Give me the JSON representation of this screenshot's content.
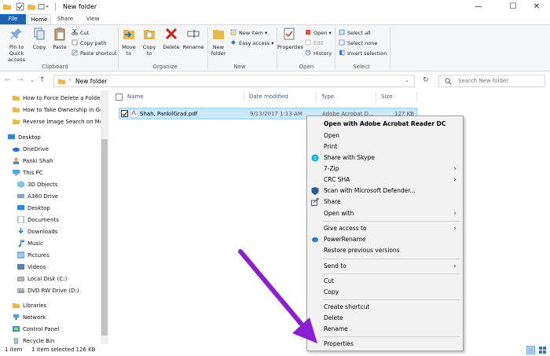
{
  "window": {
    "title": "New folder",
    "controls": {
      "minimize": "—",
      "maximize": "☐",
      "close": "✕"
    }
  },
  "ribbon_tabs": [
    "File",
    "Home",
    "Share",
    "View"
  ],
  "ribbon": {
    "pin": "Pin to Quick access",
    "copy": "Copy",
    "paste": "Paste",
    "cut": "Cut",
    "copy_path": "Copy path",
    "paste_shortcut": "Paste shortcut",
    "move_to": "Move to",
    "copy_to": "Copy to",
    "delete": "Delete",
    "rename": "Rename",
    "new_folder": "New folder",
    "new_item": "New item",
    "easy_access": "Easy access",
    "properties": "Properties",
    "open": "Open",
    "edit": "Edit",
    "history": "History",
    "select_all": "Select all",
    "select_none": "Select none",
    "invert_selection": "Invert selection",
    "groups": {
      "clipboard": "Clipboard",
      "organize": "Organize",
      "new": "New",
      "open": "Open",
      "select": "Select"
    }
  },
  "address": {
    "path": "New folder",
    "search_placeholder": "Search New folder"
  },
  "nav_pane": {
    "quick": [
      "How to Force Delete a Folder",
      "How to Take Ownership in Go",
      "Reverse Image Search on Mo"
    ],
    "desktop": "Desktop",
    "onedrive": "OneDrive",
    "user": "Panki Shah",
    "this_pc": "This PC",
    "pc_items": [
      "3D Objects",
      "A360 Drive",
      "Desktop",
      "Documents",
      "Downloads",
      "Music",
      "Pictures",
      "Videos",
      "Local Disk (C:)",
      "DVD RW Drive (D:)"
    ],
    "libraries": "Libraries",
    "network": "Network",
    "control_panel": "Control Panel",
    "recycle_bin": "Recycle Bin"
  },
  "columns": {
    "name": "Name",
    "date": "Date modified",
    "type": "Type",
    "size": "Size"
  },
  "files": [
    {
      "name": "Shah, PankilGrad.pdf",
      "date": "9/13/2017 1:13 AM",
      "type": "Adobe Acrobat D...",
      "size": "127 KB"
    }
  ],
  "context_menu": {
    "open_with_acrobat": "Open with Adobe Acrobat Reader DC",
    "open": "Open",
    "print": "Print",
    "share_skype": "Share with Skype",
    "zip": "7-Zip",
    "crc": "CRC SHA",
    "scan": "Scan with Microsoft Defender...",
    "share": "Share",
    "open_with": "Open with",
    "give_access": "Give access to",
    "power_rename": "PowerRename",
    "restore": "Restore previous versions",
    "send_to": "Send to",
    "cut": "Cut",
    "copy": "Copy",
    "create_shortcut": "Create shortcut",
    "delete": "Delete",
    "rename": "Rename",
    "properties": "Properties"
  },
  "status": {
    "items": "1 item",
    "selected": "1 item selected  126 KB"
  },
  "colors": {
    "accent": "#1a66b5",
    "selection": "#cce8ff",
    "arrow": "#8b1fd1"
  }
}
